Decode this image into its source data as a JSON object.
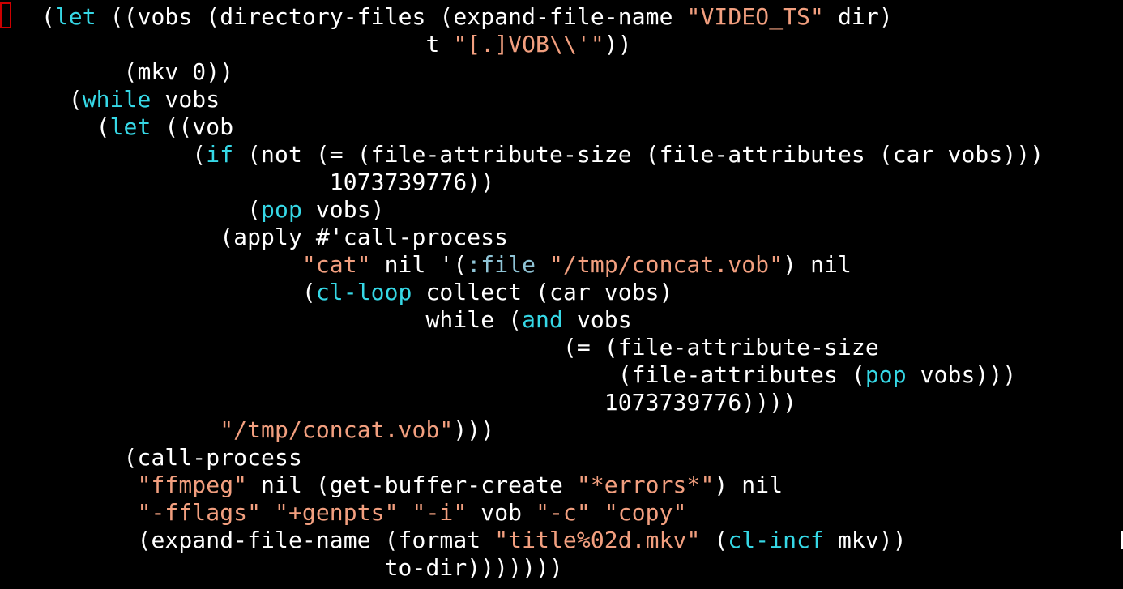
{
  "editor": {
    "colors": {
      "background": "#000000",
      "default": "#ffffff",
      "keyword": "#36d8e6",
      "string": "#f29f7f",
      "builtin": "#8fc4d6",
      "cursor": "#cc0000"
    },
    "lines": [
      [
        {
          "t": "   (",
          "c": "default"
        },
        {
          "t": "let",
          "c": "keyword"
        },
        {
          "t": " ((vobs (directory-files (expand-file-name ",
          "c": "default"
        },
        {
          "t": "\"VIDEO_TS\"",
          "c": "string"
        },
        {
          "t": " dir)",
          "c": "default"
        }
      ],
      [
        {
          "t": "                               t ",
          "c": "default"
        },
        {
          "t": "\"[.]VOB\\\\'\"",
          "c": "string"
        },
        {
          "t": "))",
          "c": "default"
        }
      ],
      [
        {
          "t": "         (mkv 0))",
          "c": "default"
        }
      ],
      [
        {
          "t": "     (",
          "c": "default"
        },
        {
          "t": "while",
          "c": "keyword"
        },
        {
          "t": " vobs",
          "c": "default"
        }
      ],
      [
        {
          "t": "       (",
          "c": "default"
        },
        {
          "t": "let",
          "c": "keyword"
        },
        {
          "t": " ((vob",
          "c": "default"
        }
      ],
      [
        {
          "t": "              (",
          "c": "default"
        },
        {
          "t": "if",
          "c": "keyword"
        },
        {
          "t": " (not (= (file-attribute-size (file-attributes (car vobs)))",
          "c": "default"
        }
      ],
      [
        {
          "t": "                        1073739776))",
          "c": "default"
        }
      ],
      [
        {
          "t": "                  (",
          "c": "default"
        },
        {
          "t": "pop",
          "c": "keyword"
        },
        {
          "t": " vobs)",
          "c": "default"
        }
      ],
      [
        {
          "t": "                (apply #'call-process",
          "c": "default"
        }
      ],
      [
        {
          "t": "                      ",
          "c": "default"
        },
        {
          "t": "\"cat\"",
          "c": "string"
        },
        {
          "t": " nil '(",
          "c": "default"
        },
        {
          "t": ":file",
          "c": "builtin"
        },
        {
          "t": " ",
          "c": "default"
        },
        {
          "t": "\"/tmp/concat.vob\"",
          "c": "string"
        },
        {
          "t": ") nil",
          "c": "default"
        }
      ],
      [
        {
          "t": "                      (",
          "c": "default"
        },
        {
          "t": "cl-loop",
          "c": "keyword"
        },
        {
          "t": " collect (car vobs)",
          "c": "default"
        }
      ],
      [
        {
          "t": "                               while (",
          "c": "default"
        },
        {
          "t": "and",
          "c": "keyword"
        },
        {
          "t": " vobs",
          "c": "default"
        }
      ],
      [
        {
          "t": "                                         (= (file-attribute-size",
          "c": "default"
        }
      ],
      [
        {
          "t": "                                             (file-attributes (",
          "c": "default"
        },
        {
          "t": "pop",
          "c": "keyword"
        },
        {
          "t": " vobs)))",
          "c": "default"
        }
      ],
      [
        {
          "t": "                                            1073739776))))",
          "c": "default"
        }
      ],
      [
        {
          "t": "                ",
          "c": "default"
        },
        {
          "t": "\"/tmp/concat.vob\"",
          "c": "string"
        },
        {
          "t": ")))",
          "c": "default"
        }
      ],
      [
        {
          "t": "         (call-process",
          "c": "default"
        }
      ],
      [
        {
          "t": "          ",
          "c": "default"
        },
        {
          "t": "\"ffmpeg\"",
          "c": "string"
        },
        {
          "t": " nil (get-buffer-create ",
          "c": "default"
        },
        {
          "t": "\"*errors*\"",
          "c": "string"
        },
        {
          "t": ") nil",
          "c": "default"
        }
      ],
      [
        {
          "t": "          ",
          "c": "default"
        },
        {
          "t": "\"-fflags\"",
          "c": "string"
        },
        {
          "t": " ",
          "c": "default"
        },
        {
          "t": "\"+genpts\"",
          "c": "string"
        },
        {
          "t": " ",
          "c": "default"
        },
        {
          "t": "\"-i\"",
          "c": "string"
        },
        {
          "t": " vob ",
          "c": "default"
        },
        {
          "t": "\"-c\"",
          "c": "string"
        },
        {
          "t": " ",
          "c": "default"
        },
        {
          "t": "\"copy\"",
          "c": "string"
        }
      ],
      [
        {
          "t": "          (expand-file-name (format ",
          "c": "default"
        },
        {
          "t": "\"title%02d.mkv\"",
          "c": "string"
        },
        {
          "t": " (",
          "c": "default"
        },
        {
          "t": "cl-incf",
          "c": "keyword"
        },
        {
          "t": " mkv))",
          "c": "default"
        }
      ],
      [
        {
          "t": "                            to-dir)))))))",
          "c": "default"
        }
      ]
    ]
  }
}
